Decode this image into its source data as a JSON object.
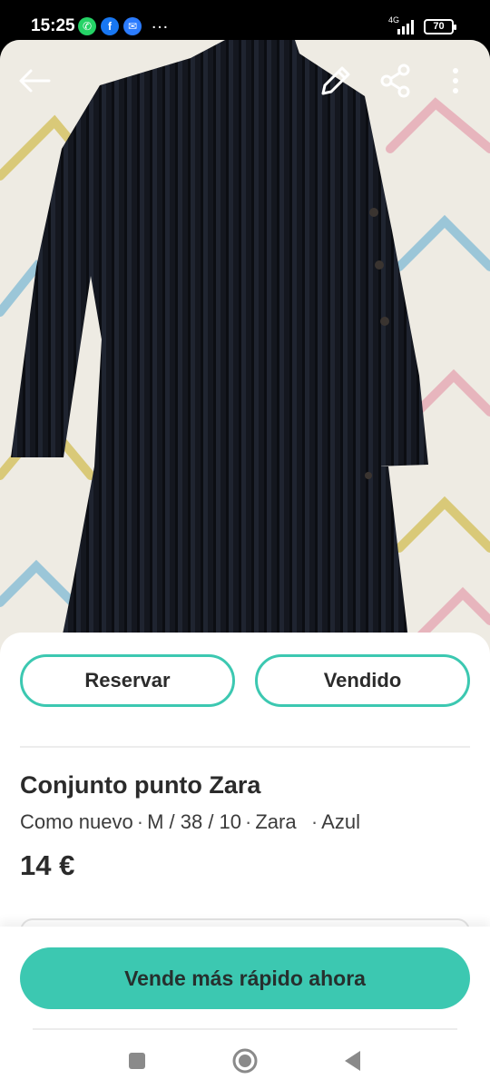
{
  "status_bar": {
    "time": "15:25",
    "notifications": [
      "whatsapp-icon",
      "facebook-icon",
      "messenger-icon"
    ],
    "more": "…",
    "network": "4G",
    "battery": "70"
  },
  "toolbar": {
    "back_icon": "arrow-left-icon",
    "edit_icon": "pencil-icon",
    "share_icon": "share-icon",
    "more_icon": "kebab-menu-icon"
  },
  "actions": {
    "reserve_label": "Reservar",
    "sold_label": "Vendido"
  },
  "item": {
    "title": "Conjunto punto Zara",
    "condition": "Como nuevo",
    "size": "M / 38 / 10",
    "brand": "Zara",
    "color": "Azul",
    "price": "14 €"
  },
  "cta": {
    "label": "Vende más rápido ahora"
  },
  "colors": {
    "accent": "#3cc8b1"
  }
}
